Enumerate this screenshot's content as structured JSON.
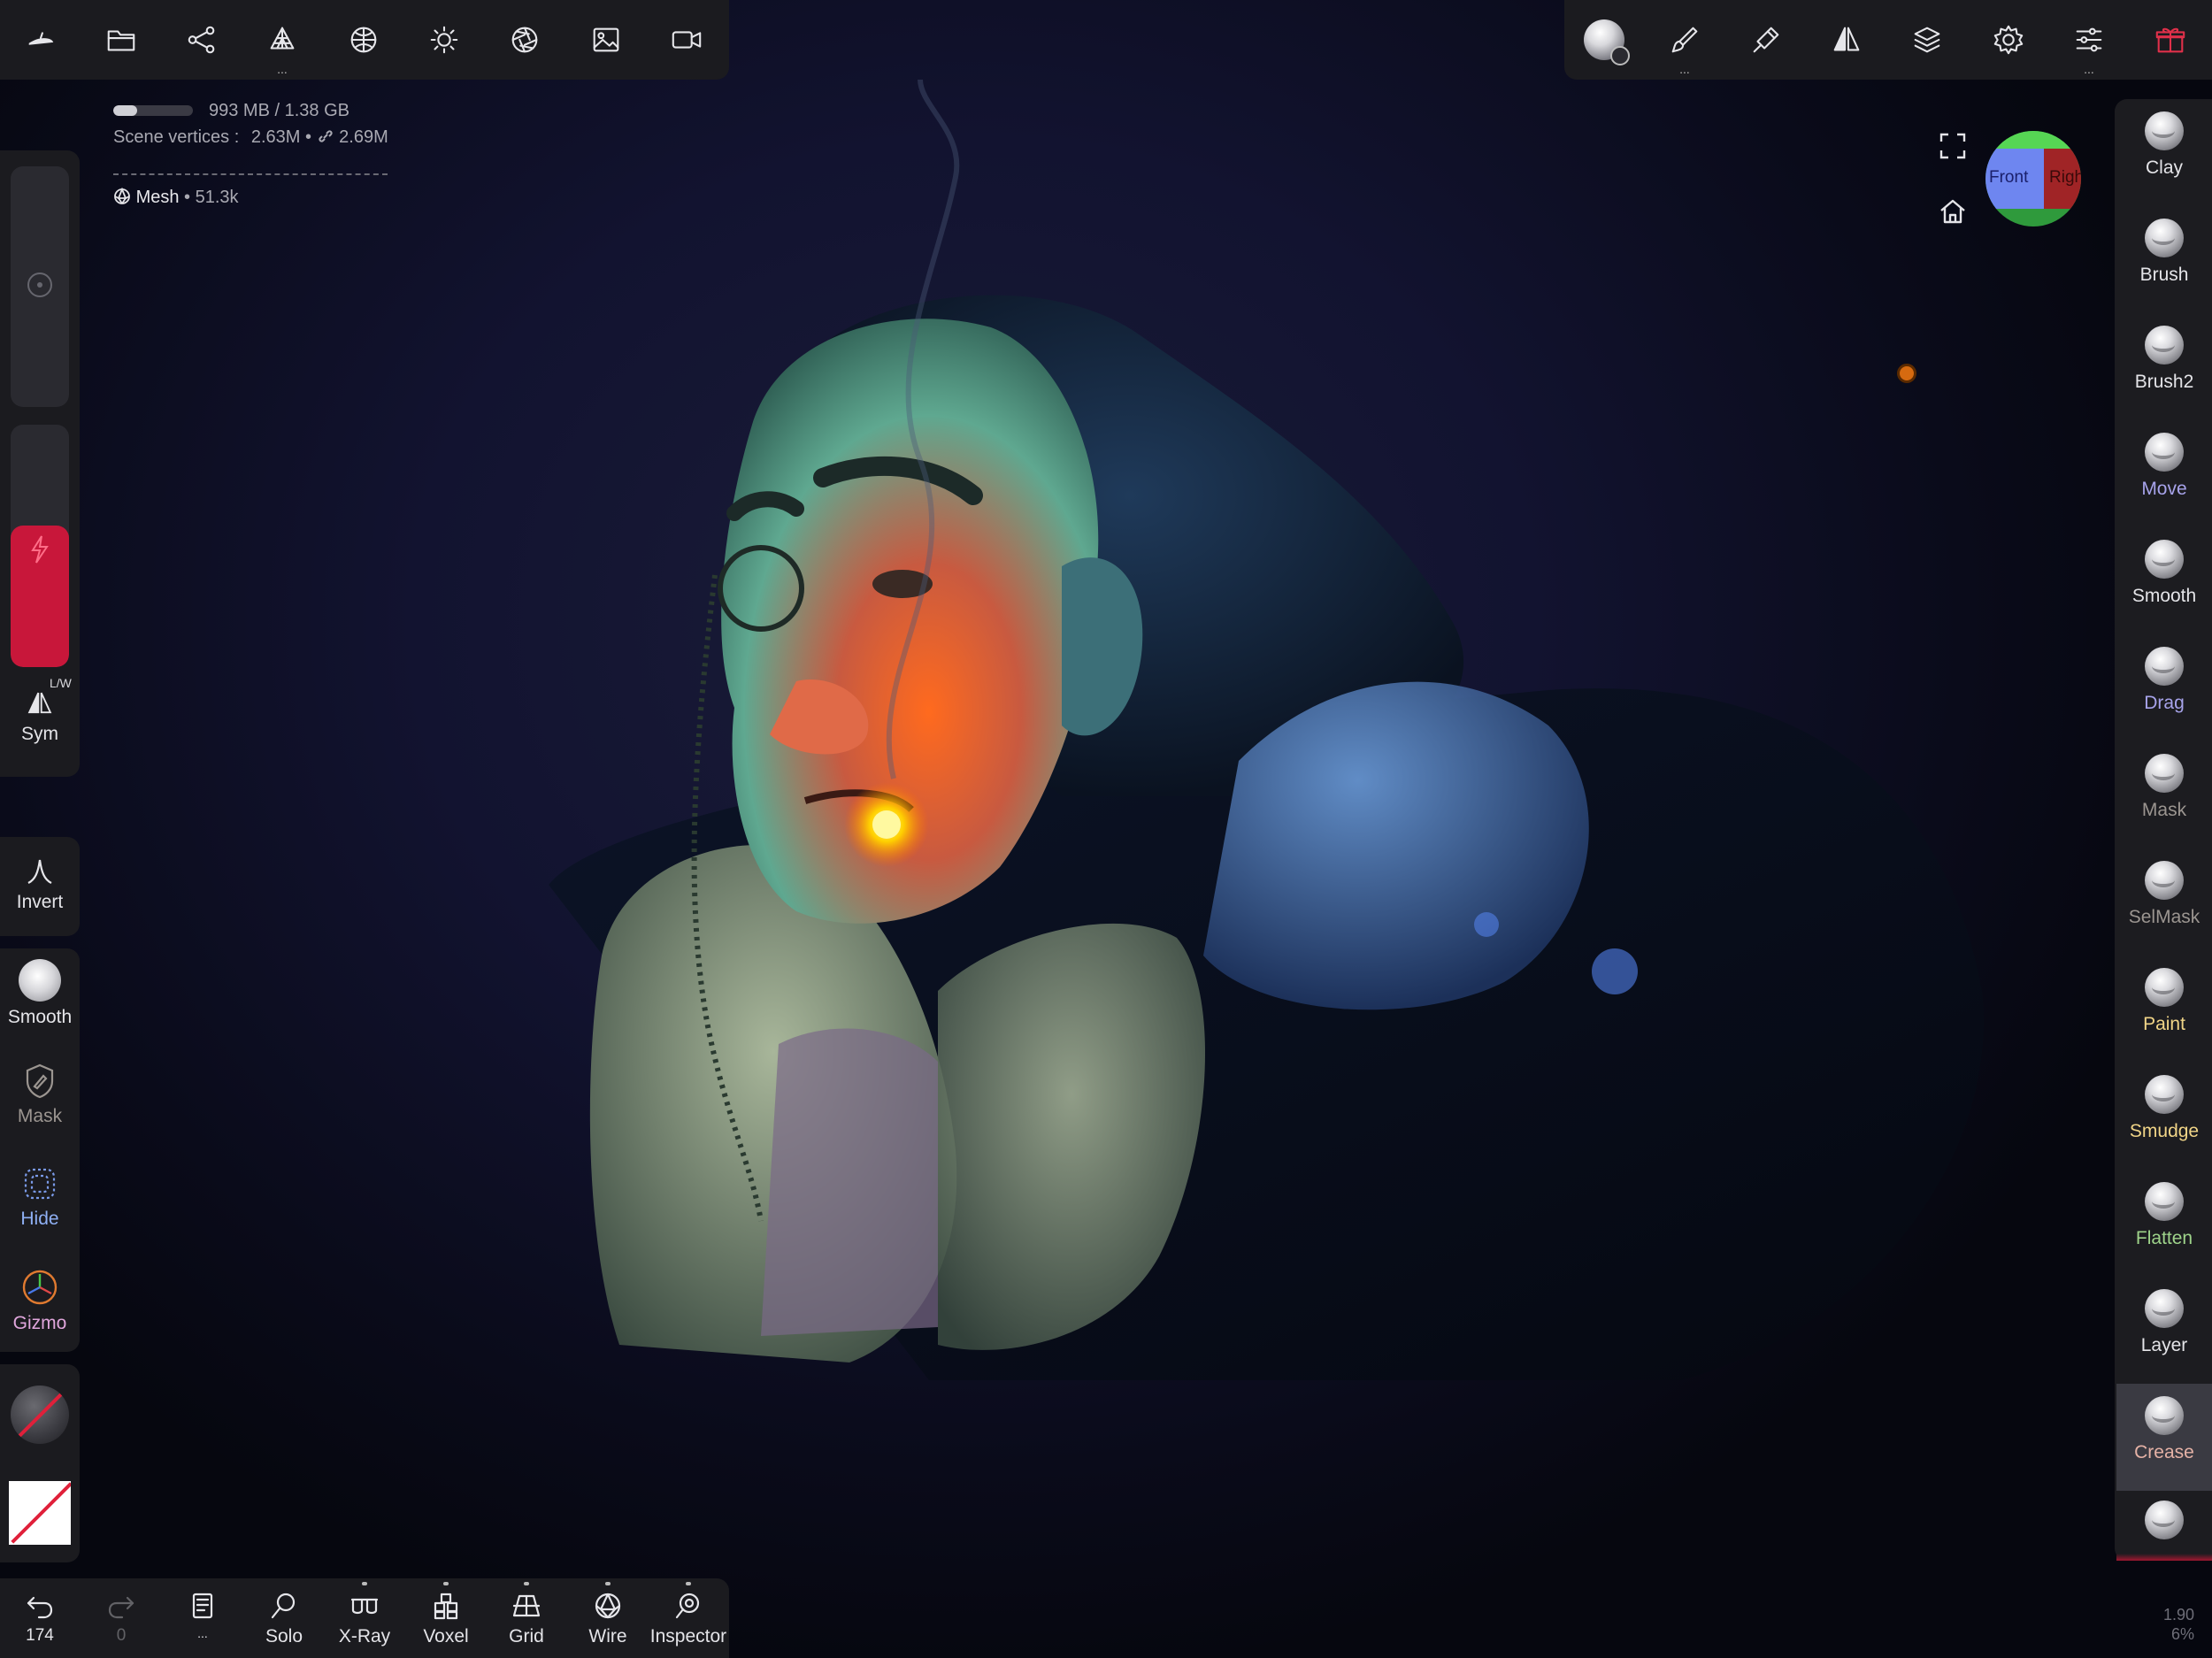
{
  "top_toolbar_left": [
    {
      "icon": "nomad-logo-icon"
    },
    {
      "icon": "folder-icon"
    },
    {
      "icon": "scene-graph-icon"
    },
    {
      "icon": "topology-icon",
      "more": "..."
    },
    {
      "icon": "material-sphere-icon"
    },
    {
      "icon": "light-icon"
    },
    {
      "icon": "camera-aperture-icon"
    },
    {
      "icon": "image-icon"
    },
    {
      "icon": "video-camera-icon"
    }
  ],
  "top_toolbar_right": [
    {
      "icon": "active-tool-sphere-icon"
    },
    {
      "icon": "paint-brush-icon",
      "more": "..."
    },
    {
      "icon": "stroke-pen-icon"
    },
    {
      "icon": "symmetry-icon"
    },
    {
      "icon": "layers-icon"
    },
    {
      "icon": "settings-gear-icon"
    },
    {
      "icon": "sliders-icon",
      "more": "..."
    },
    {
      "icon": "gift-icon"
    }
  ],
  "scene_info": {
    "memory": "993 MB / 1.38 GB",
    "memory_fraction": 0.3,
    "vertices_label": "Scene vertices :",
    "vertices_value": "2.63M",
    "vertices_sep": "•",
    "vertices_linked": "2.69M",
    "mesh_label": "Mesh",
    "mesh_count": "• 51.3k"
  },
  "view_cube": {
    "front": "Front",
    "right": "Righ"
  },
  "tools": [
    {
      "label": "Clay",
      "color": "#e4e4e8"
    },
    {
      "label": "Brush",
      "color": "#e4e4e8"
    },
    {
      "label": "Brush2",
      "color": "#e4e4e8"
    },
    {
      "label": "Move",
      "color": "#a7a3ea"
    },
    {
      "label": "Smooth",
      "color": "#e4e4e8"
    },
    {
      "label": "Drag",
      "color": "#a7a3ea"
    },
    {
      "label": "Mask",
      "color": "#9b9590"
    },
    {
      "label": "SelMask",
      "color": "#9b9590"
    },
    {
      "label": "Paint",
      "color": "#f0d487"
    },
    {
      "label": "Smudge",
      "color": "#f0d487"
    },
    {
      "label": "Flatten",
      "color": "#9ed38a"
    },
    {
      "label": "Layer",
      "color": "#e4e4e8"
    },
    {
      "label": "Crease",
      "color": "#e5b2a6",
      "selected": true
    }
  ],
  "left_panel": {
    "sym_label": "Sym",
    "sym_badge": "L/W",
    "invert_label": "Invert",
    "smooth_label": "Smooth",
    "mask_label": "Mask",
    "hide_label": "Hide",
    "gizmo_label": "Gizmo",
    "accent_color": "#c8173a"
  },
  "bottom_bar": {
    "undo_count": "174",
    "redo_count": "0",
    "more": "...",
    "items": [
      "Solo",
      "X-Ray",
      "Voxel",
      "Grid",
      "Wire",
      "Inspector"
    ]
  },
  "corner_stats": {
    "line1": "1.90",
    "line2": "6%"
  }
}
